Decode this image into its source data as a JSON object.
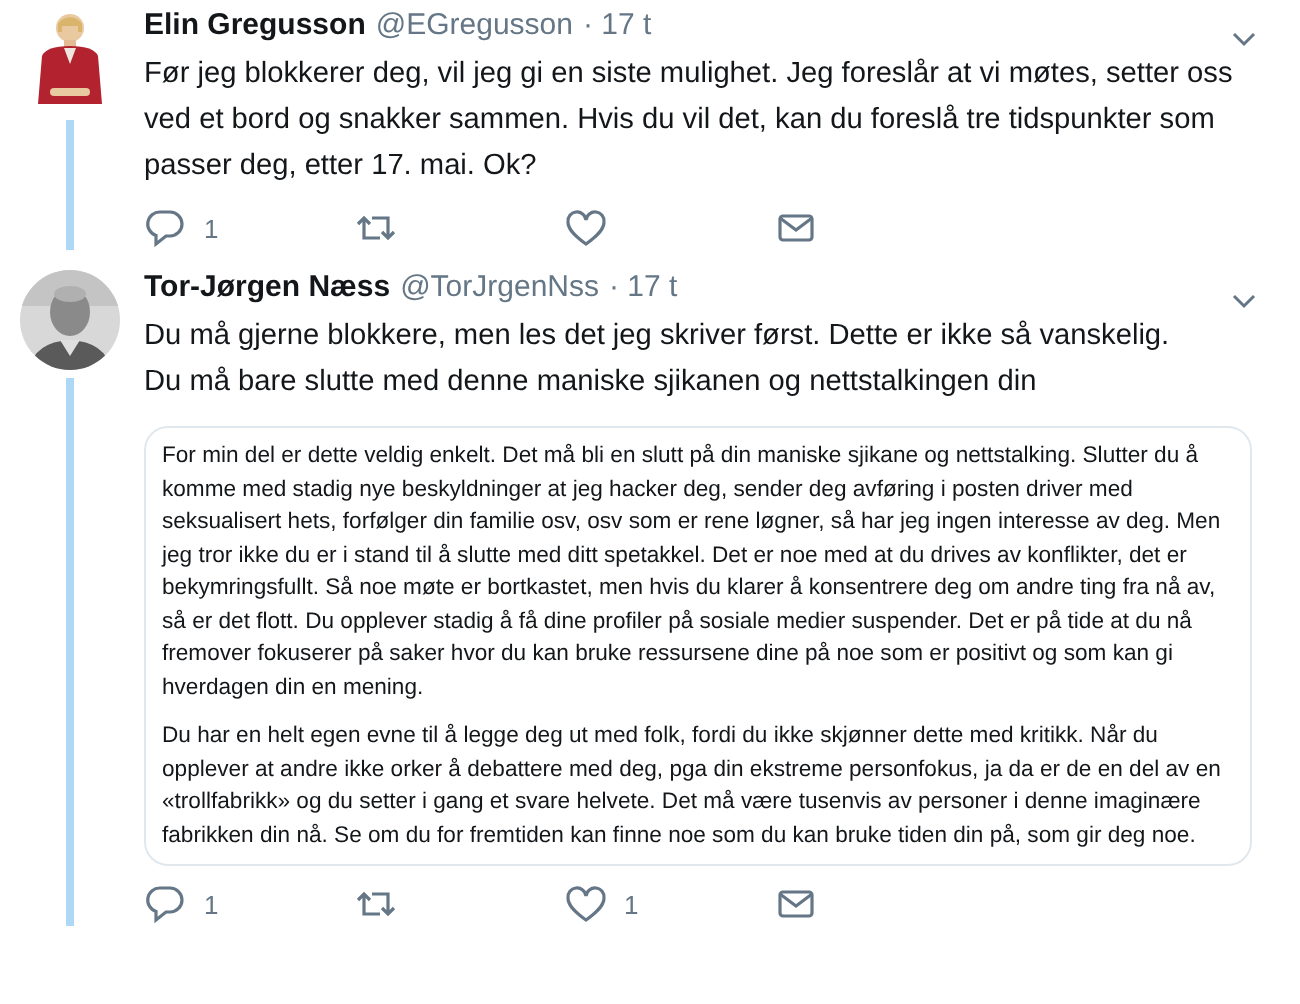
{
  "tweets": [
    {
      "author": "Elin Gregusson",
      "handle": "@EGregusson",
      "time": "· 17 t",
      "text": [
        "Før jeg blokkerer deg, vil jeg gi en siste mulighet. Jeg foreslår at vi møtes, setter oss ved et bord og snakker sammen. Hvis du vil det, kan du foreslå tre tidspunkter som passer deg, etter 17. mai. Ok?"
      ],
      "actions": [
        {
          "kind": "reply",
          "count": "1"
        },
        {
          "kind": "retweet"
        },
        {
          "kind": "like"
        },
        {
          "kind": "message"
        }
      ]
    },
    {
      "author": "Tor-Jørgen Næss",
      "handle": "@TorJrgenNss",
      "time": "· 17 t",
      "text": [
        "Du må gjerne blokkere, men les det jeg skriver først. Dette er ikke så vanskelig.",
        "Du må bare slutte med denne maniske sjikanen og nettstalkingen din"
      ],
      "document": [
        "For min del er dette veldig enkelt. Det må bli en slutt på din maniske sjikane og nettstalking. Slutter du å komme med stadig nye beskyldninger at jeg hacker deg, sender deg avføring i posten driver med seksualisert hets, forfølger din familie osv, osv som er rene løgner, så har jeg ingen interesse av deg. Men jeg tror ikke du er i stand til å slutte med ditt spetakkel. Det er noe med at du drives av konflikter, det er bekymringsfullt. Så noe møte er bortkastet, men hvis du klarer å konsentrere deg om andre ting fra nå av, så er det flott.  Du opplever stadig å få dine profiler på sosiale medier suspender. Det er på tide at du nå fremover fokuserer på saker hvor du kan bruke ressursene dine på noe som er positivt og som kan gi hverdagen din en mening.",
        "Du har en helt egen evne til å legge deg ut med folk, fordi du ikke skjønner dette med kritikk. Når du opplever at andre ikke orker å debattere med deg, pga din ekstreme personfokus, ja da er de en del av en «trollfabrikk» og du setter i gang et svare helvete. Det må være tusenvis av personer i denne imaginære fabrikken din nå. Se om du for fremtiden kan finne noe som du kan bruke tiden din på, som gir deg noe."
      ],
      "actions": [
        {
          "kind": "reply",
          "count": "1"
        },
        {
          "kind": "retweet"
        },
        {
          "kind": "like",
          "count": "1"
        },
        {
          "kind": "message"
        }
      ]
    }
  ]
}
